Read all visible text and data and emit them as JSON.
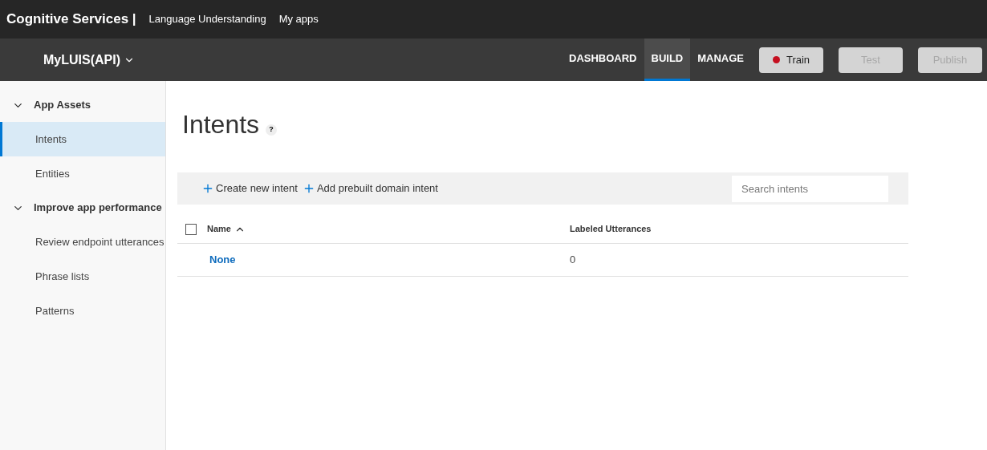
{
  "top_bar": {
    "brand": "Cognitive Services |",
    "links": [
      "Language Understanding",
      "My apps"
    ]
  },
  "app_bar": {
    "app_name": "MyLUIS(API)",
    "tabs": [
      {
        "label": "DASHBOARD",
        "selected": false
      },
      {
        "label": "BUILD",
        "selected": true
      },
      {
        "label": "MANAGE",
        "selected": false
      }
    ],
    "buttons": [
      {
        "label": "Train",
        "disabled": false,
        "dot": true
      },
      {
        "label": "Test",
        "disabled": true,
        "dot": false
      },
      {
        "label": "Publish",
        "disabled": true,
        "dot": false
      }
    ]
  },
  "sidebar": {
    "groups": [
      {
        "label": "App Assets",
        "expanded": true,
        "children": [
          {
            "label": "Intents",
            "selected": true
          },
          {
            "label": "Entities",
            "selected": false
          }
        ]
      },
      {
        "label": "Improve app performance",
        "expanded": true,
        "children": [
          {
            "label": "Review endpoint utterances",
            "selected": false
          },
          {
            "label": "Phrase lists",
            "selected": false
          },
          {
            "label": "Patterns",
            "selected": false
          }
        ]
      }
    ]
  },
  "page": {
    "title": "Intents",
    "help": "?"
  },
  "toolbar": {
    "actions": [
      "Create new intent",
      "Add prebuilt domain intent"
    ],
    "search": {
      "placeholder": "Search intents"
    }
  },
  "table": {
    "select_all": {
      "checked": false
    },
    "columns": [
      {
        "label": "Name",
        "sorted": true
      },
      {
        "label": "Labeled Utterances",
        "sorted": false
      }
    ],
    "rows": [
      {
        "name": "None",
        "labeled_utterances": "0"
      }
    ]
  }
}
